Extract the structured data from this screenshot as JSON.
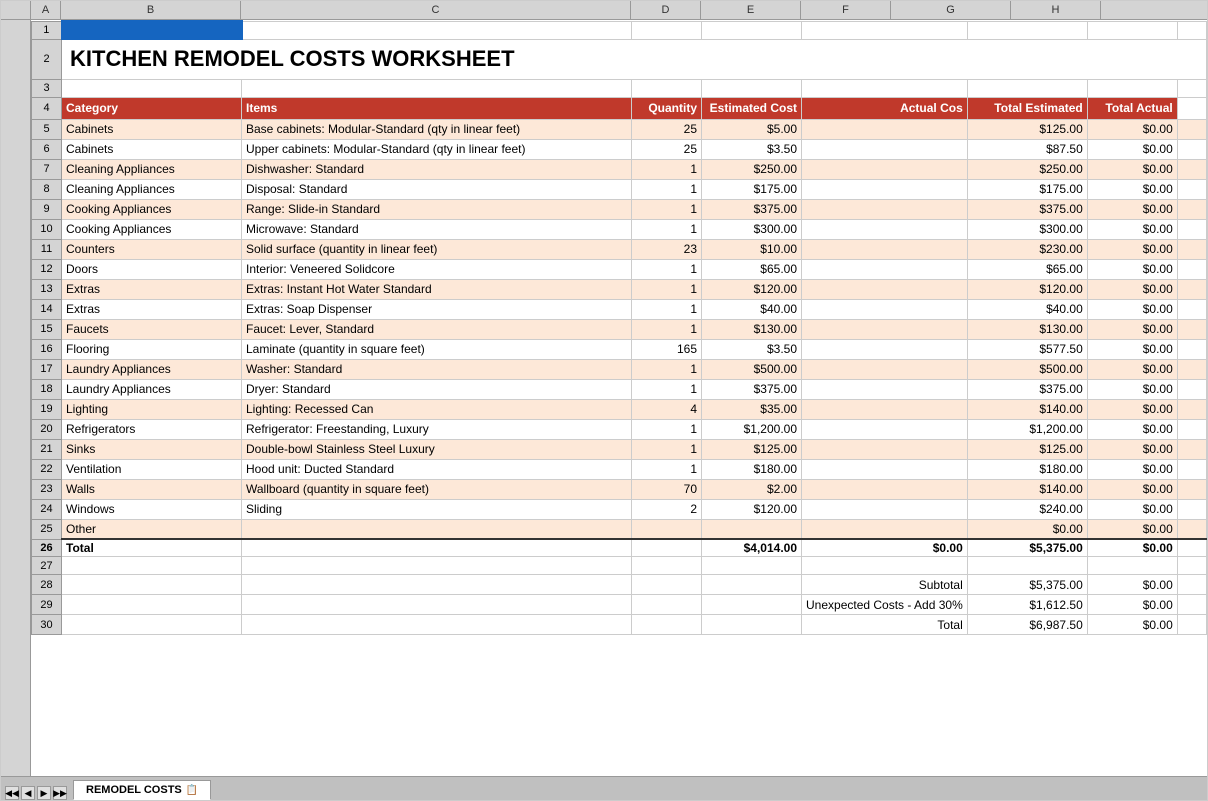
{
  "title": "KITCHEN REMODEL COSTS WORKSHEET",
  "sheet_tab": "REMODEL COSTS",
  "columns": {
    "A": "A",
    "B": "B",
    "C": "C",
    "D": "D",
    "E": "E",
    "F": "F",
    "G": "G",
    "H": "H"
  },
  "header": {
    "category": "Category",
    "items": "Items",
    "quantity": "Quantity",
    "estimated_cost": "Estimated Cost",
    "actual_cost": "Actual Cos",
    "total_estimated": "Total Estimated",
    "total_actual": "Total Actual"
  },
  "rows": [
    {
      "category": "Cabinets",
      "item": "Base cabinets: Modular-Standard (qty in linear feet)",
      "qty": "25",
      "est": "$5.00",
      "actual": "",
      "total_est": "$125.00",
      "total_act": "$0.00"
    },
    {
      "category": "Cabinets",
      "item": "Upper cabinets: Modular-Standard (qty in linear feet)",
      "qty": "25",
      "est": "$3.50",
      "actual": "",
      "total_est": "$87.50",
      "total_act": "$0.00"
    },
    {
      "category": "Cleaning Appliances",
      "item": "Dishwasher: Standard",
      "qty": "1",
      "est": "$250.00",
      "actual": "",
      "total_est": "$250.00",
      "total_act": "$0.00"
    },
    {
      "category": "Cleaning Appliances",
      "item": "Disposal: Standard",
      "qty": "1",
      "est": "$175.00",
      "actual": "",
      "total_est": "$175.00",
      "total_act": "$0.00"
    },
    {
      "category": "Cooking Appliances",
      "item": "Range: Slide-in Standard",
      "qty": "1",
      "est": "$375.00",
      "actual": "",
      "total_est": "$375.00",
      "total_act": "$0.00"
    },
    {
      "category": "Cooking Appliances",
      "item": "Microwave: Standard",
      "qty": "1",
      "est": "$300.00",
      "actual": "",
      "total_est": "$300.00",
      "total_act": "$0.00"
    },
    {
      "category": "Counters",
      "item": "Solid surface (quantity in linear feet)",
      "qty": "23",
      "est": "$10.00",
      "actual": "",
      "total_est": "$230.00",
      "total_act": "$0.00"
    },
    {
      "category": "Doors",
      "item": "Interior: Veneered Solidcore",
      "qty": "1",
      "est": "$65.00",
      "actual": "",
      "total_est": "$65.00",
      "total_act": "$0.00"
    },
    {
      "category": "Extras",
      "item": "Extras: Instant Hot Water Standard",
      "qty": "1",
      "est": "$120.00",
      "actual": "",
      "total_est": "$120.00",
      "total_act": "$0.00"
    },
    {
      "category": "Extras",
      "item": "Extras: Soap Dispenser",
      "qty": "1",
      "est": "$40.00",
      "actual": "",
      "total_est": "$40.00",
      "total_act": "$0.00"
    },
    {
      "category": "Faucets",
      "item": "Faucet: Lever, Standard",
      "qty": "1",
      "est": "$130.00",
      "actual": "",
      "total_est": "$130.00",
      "total_act": "$0.00"
    },
    {
      "category": "Flooring",
      "item": "Laminate (quantity in square feet)",
      "qty": "165",
      "est": "$3.50",
      "actual": "",
      "total_est": "$577.50",
      "total_act": "$0.00"
    },
    {
      "category": "Laundry Appliances",
      "item": "Washer: Standard",
      "qty": "1",
      "est": "$500.00",
      "actual": "",
      "total_est": "$500.00",
      "total_act": "$0.00"
    },
    {
      "category": "Laundry Appliances",
      "item": "Dryer: Standard",
      "qty": "1",
      "est": "$375.00",
      "actual": "",
      "total_est": "$375.00",
      "total_act": "$0.00"
    },
    {
      "category": "Lighting",
      "item": "Lighting: Recessed Can",
      "qty": "4",
      "est": "$35.00",
      "actual": "",
      "total_est": "$140.00",
      "total_act": "$0.00"
    },
    {
      "category": "Refrigerators",
      "item": "Refrigerator: Freestanding, Luxury",
      "qty": "1",
      "est": "$1,200.00",
      "actual": "",
      "total_est": "$1,200.00",
      "total_act": "$0.00"
    },
    {
      "category": "Sinks",
      "item": "Double-bowl Stainless Steel Luxury",
      "qty": "1",
      "est": "$125.00",
      "actual": "",
      "total_est": "$125.00",
      "total_act": "$0.00"
    },
    {
      "category": "Ventilation",
      "item": "Hood unit: Ducted Standard",
      "qty": "1",
      "est": "$180.00",
      "actual": "",
      "total_est": "$180.00",
      "total_act": "$0.00"
    },
    {
      "category": "Walls",
      "item": "Wallboard (quantity in square feet)",
      "qty": "70",
      "est": "$2.00",
      "actual": "",
      "total_est": "$140.00",
      "total_act": "$0.00"
    },
    {
      "category": "Windows",
      "item": "Sliding",
      "qty": "2",
      "est": "$120.00",
      "actual": "",
      "total_est": "$240.00",
      "total_act": "$0.00"
    },
    {
      "category": "Other",
      "item": "",
      "qty": "",
      "est": "",
      "actual": "",
      "total_est": "$0.00",
      "total_act": "$0.00"
    }
  ],
  "total_row": {
    "label": "Total",
    "est_total": "$4,014.00",
    "actual_total": "$0.00",
    "total_est": "$5,375.00",
    "total_act": "$0.00"
  },
  "summary": {
    "subtotal_label": "Subtotal",
    "subtotal_est": "$5,375.00",
    "subtotal_act": "$0.00",
    "unexpected_label": "Unexpected Costs - Add 30%",
    "unexpected_est": "$1,612.50",
    "unexpected_act": "$0.00",
    "total_label": "Total",
    "total_est": "$6,987.50",
    "total_act": "$0.00"
  },
  "row_numbers": [
    "1",
    "2",
    "3",
    "4",
    "5",
    "6",
    "7",
    "8",
    "9",
    "10",
    "11",
    "12",
    "13",
    "14",
    "15",
    "16",
    "17",
    "18",
    "19",
    "20",
    "21",
    "22",
    "23",
    "24",
    "25",
    "26",
    "27",
    "28",
    "29",
    "30"
  ]
}
